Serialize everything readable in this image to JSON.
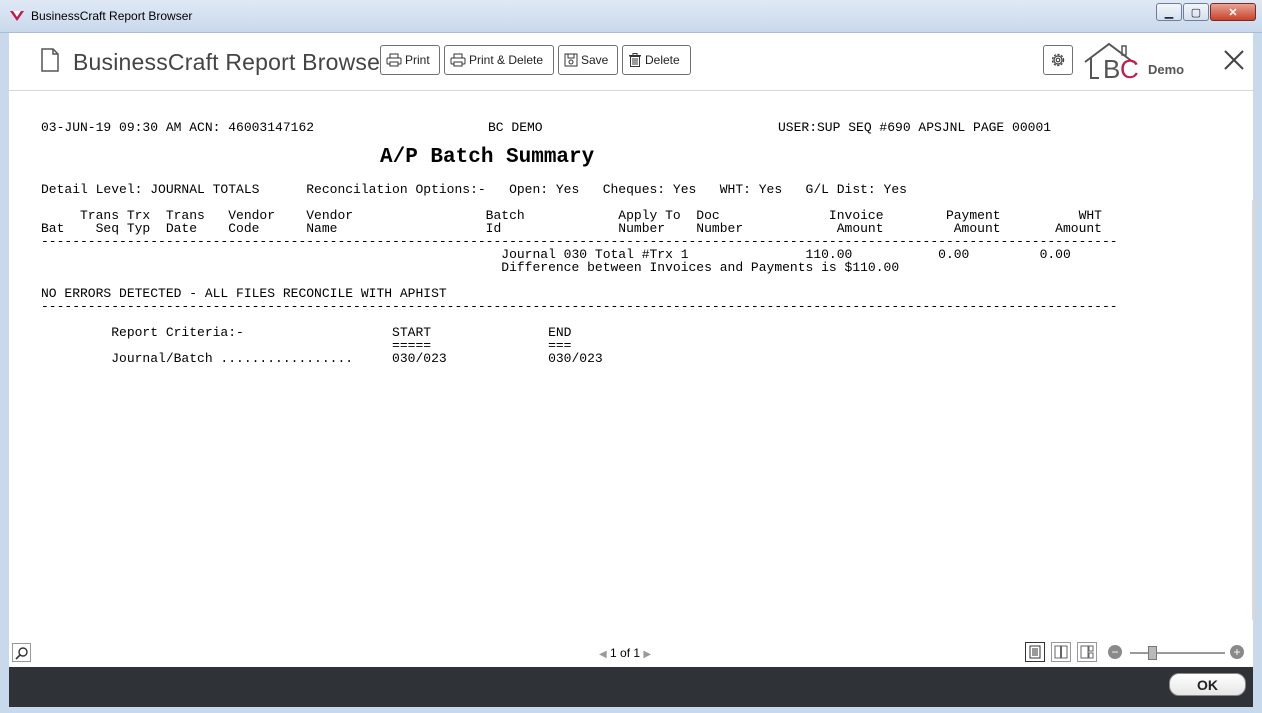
{
  "window": {
    "title": "BusinessCraft Report Browser",
    "minimize_label": "▁",
    "maximize_label": "▢",
    "close_label": "✕"
  },
  "header": {
    "app_title": "BusinessCraft Report Browser",
    "buttons": {
      "print": "Print",
      "print_delete": "Print & Delete",
      "save": "Save",
      "delete": "Delete"
    },
    "logo_demo": "Demo"
  },
  "report": {
    "line1_left": "03-JUN-19 09:30 AM ACN: 46003147162",
    "line1_center": "BC DEMO",
    "line1_right": "USER:SUP SEQ #690 APSJNL PAGE 00001",
    "title": "A/P Batch Summary",
    "options_line": "Detail Level: JOURNAL TOTALS      Reconcilation Options:-   Open: Yes   Cheques: Yes   WHT: Yes   G/L Dist: Yes",
    "columns_row1": "     Trans Trx  Trans   Vendor    Vendor                 Batch            Apply To  Doc              Invoice        Payment          WHT",
    "columns_row2": "Bat    Seq Typ  Date    Code      Name                   Id               Number    Number            Amount         Amount       Amount",
    "separator": "------------------------------------------------------------------------------------------------------------------------------------------",
    "journal_total_line": "                                                           Journal 030 Total #Trx 1               110.00           0.00         0.00",
    "difference_line": "                                                           Difference between Invoices and Payments is $110.00",
    "no_errors": "NO ERRORS DETECTED - ALL FILES RECONCILE WITH APHIST",
    "criteria_label": "         Report Criteria:-                   START               END",
    "criteria_underline": "                                             =====               ===",
    "criteria_row": "         Journal/Batch .................     030/023             030/023"
  },
  "status": {
    "page_indicator": "1 of 1",
    "prev_arrow": "◀",
    "next_arrow": "▶",
    "zoom_minus": "−",
    "zoom_plus": "+",
    "zoom_level_fraction": 0.25
  },
  "footer": {
    "ok_label": "OK"
  },
  "colors": {
    "footer_bg": "#2f3338",
    "logo_red": "#c2184b",
    "frame": "#c9d9ec"
  },
  "icons": [
    "app-logo-icon",
    "document-icon",
    "printer-icon",
    "save-icon",
    "trash-icon",
    "gear-icon",
    "house-logo-icon",
    "close-icon",
    "magnifier-icon",
    "single-page-icon",
    "two-page-icon",
    "multi-page-icon"
  ]
}
